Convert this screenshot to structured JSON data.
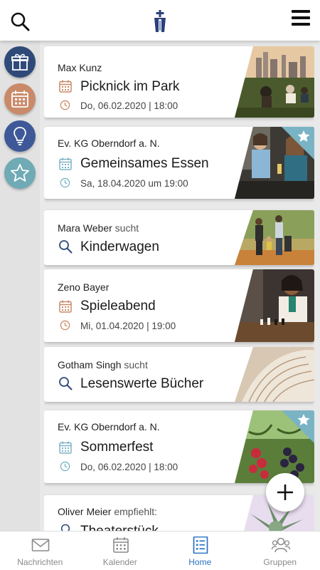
{
  "header": {
    "search_icon": "search-icon",
    "logo": "church-logo",
    "menu_icon": "hamburger-menu-icon"
  },
  "categories": [
    {
      "name": "gift-icon",
      "color": "#2f4a78"
    },
    {
      "name": "calendar-icon",
      "color": "#c98a69"
    },
    {
      "name": "lightbulb-icon",
      "color": "#3e5898"
    },
    {
      "name": "star-icon",
      "color": "#6faab5"
    }
  ],
  "cards": [
    {
      "author": "Max Kunz",
      "suffix": "",
      "title": "Picknick im Park",
      "date": "Do, 06.02.2020 | 18:00",
      "type": "event",
      "accent": "#c98a69",
      "starred": false
    },
    {
      "author": "Ev. KG Oberndorf a. N.",
      "suffix": "",
      "title": "Gemeinsames Essen",
      "date": "Sa, 18.04.2020 um 19:00",
      "type": "event",
      "accent": "#7ab3c4",
      "starred": true
    },
    {
      "author": "Mara Weber",
      "suffix": "sucht",
      "title": "Kinderwagen",
      "date": "",
      "type": "search",
      "accent": "#2f4a78",
      "starred": false
    },
    {
      "author": "Zeno Bayer",
      "suffix": "",
      "title": "Spieleabend",
      "date": "Mi, 01.04.2020 | 19:00",
      "type": "event",
      "accent": "#c98a69",
      "starred": false
    },
    {
      "author": "Gotham Singh",
      "suffix": "sucht",
      "title": "Lesenswerte Bücher",
      "date": "",
      "type": "search",
      "accent": "#2f4a78",
      "starred": false
    },
    {
      "author": "Ev. KG Oberndorf a. N.",
      "suffix": "",
      "title": "Sommerfest",
      "date": "Do, 06.02.2020 | 18:00",
      "type": "event",
      "accent": "#7ab3c4",
      "starred": true
    },
    {
      "author": "Oliver Meier",
      "suffix": "empfiehlt:",
      "title": "Theaterstück",
      "date": "",
      "type": "recommend",
      "accent": "#2f4a78",
      "starred": false
    }
  ],
  "fab": {
    "icon": "plus-icon"
  },
  "nav": [
    {
      "label": "Nachrichten",
      "icon": "mail-icon",
      "active": false
    },
    {
      "label": "Kalender",
      "icon": "calendar-icon",
      "active": false
    },
    {
      "label": "Home",
      "icon": "home-list-icon",
      "active": true
    },
    {
      "label": "Gruppen",
      "icon": "groups-icon",
      "active": false
    }
  ]
}
